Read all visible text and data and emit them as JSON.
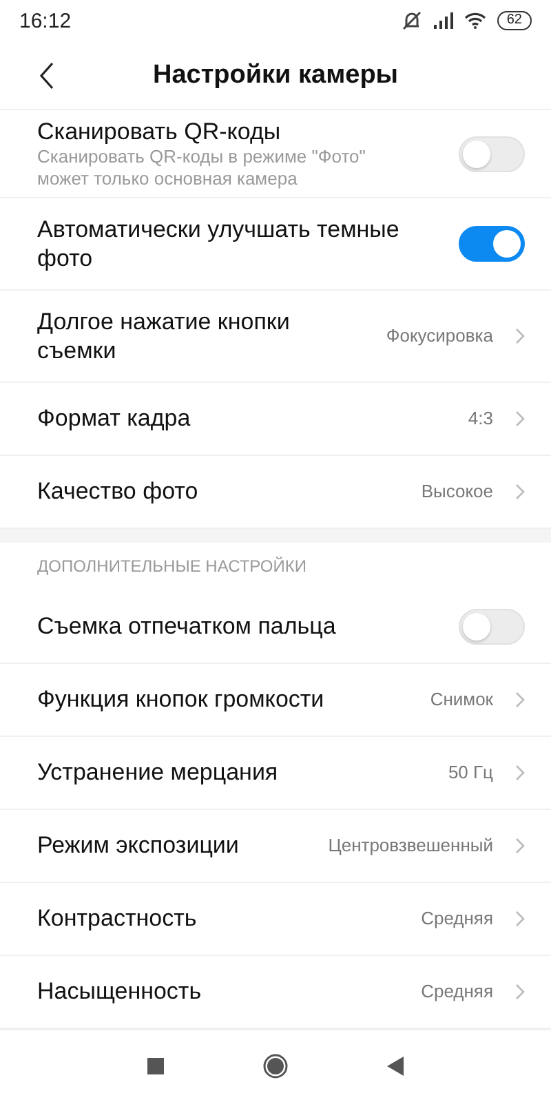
{
  "status_bar": {
    "time": "16:12",
    "battery": "62"
  },
  "header": {
    "title": "Настройки камеры"
  },
  "sections": [
    {
      "items": [
        {
          "kind": "toggle",
          "label": "Сканировать QR-коды",
          "subtitle": "Сканировать QR-коды в режиме \"Фото\" может только основная камера",
          "on": false
        },
        {
          "kind": "toggle",
          "label": "Автоматически улучшать темные фото",
          "on": true
        },
        {
          "kind": "value",
          "label": "Долгое нажатие кнопки съемки",
          "value": "Фокусировка"
        },
        {
          "kind": "value",
          "label": "Формат кадра",
          "value": "4:3"
        },
        {
          "kind": "value",
          "label": "Качество фото",
          "value": "Высокое"
        }
      ]
    },
    {
      "title": "ДОПОЛНИТЕЛЬНЫЕ НАСТРОЙКИ",
      "items": [
        {
          "kind": "toggle",
          "label": "Съемка отпечатком пальца",
          "on": false
        },
        {
          "kind": "value",
          "label": "Функция кнопок громкости",
          "value": "Снимок"
        },
        {
          "kind": "value",
          "label": "Устранение мерцания",
          "value": "50 Гц"
        },
        {
          "kind": "value",
          "label": "Режим экспозиции",
          "value": "Центровзвешенный"
        },
        {
          "kind": "value",
          "label": "Контрастность",
          "value": "Средняя"
        },
        {
          "kind": "value",
          "label": "Насыщенность",
          "value": "Средняя"
        }
      ]
    }
  ]
}
